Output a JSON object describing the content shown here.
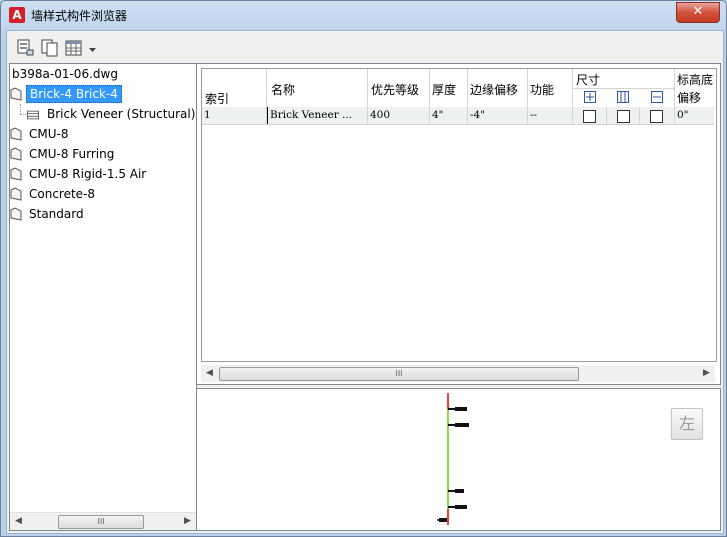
{
  "window": {
    "title": "墙样式构件浏览器",
    "close_label": "✕"
  },
  "toolbar": {
    "buttons": [
      {
        "icon": "import-wall-style-icon"
      },
      {
        "icon": "copy-icon"
      },
      {
        "icon": "table-view-icon"
      }
    ],
    "dropdown_icon": "chevron-down-icon"
  },
  "tree": {
    "root": "b398a-01-06.dwg",
    "items": [
      {
        "label": "Brick-4 Brick-4",
        "selected": true,
        "children": [
          {
            "label": "Brick Veneer (Structural)"
          }
        ]
      },
      {
        "label": "CMU-8"
      },
      {
        "label": "CMU-8 Furring"
      },
      {
        "label": "CMU-8 Rigid-1.5 Air"
      },
      {
        "label": "Concrete-8"
      },
      {
        "label": "Standard"
      }
    ]
  },
  "grid": {
    "headers": {
      "index": "索引",
      "name": "名称",
      "priority": "优先等级",
      "thickness": "厚度",
      "edge_offset": "边缘偏移",
      "function": "功能",
      "dimension": "尺寸",
      "base_height_line1": "标高底",
      "base_height_line2": "偏移"
    },
    "dimension_icons": [
      "dim-exterior-icon",
      "dim-center-icon",
      "dim-interior-icon"
    ],
    "rows": [
      {
        "index": "1",
        "name": "Brick Veneer ...",
        "priority": "400",
        "thickness": "4\"",
        "edge_offset": "-4\"",
        "function": "--",
        "dim_checks": [
          false,
          false,
          false
        ],
        "base_offset": "0\""
      }
    ]
  },
  "preview": {
    "view_button_label": "左",
    "accent_red": "#e00000",
    "accent_green": "#66cc00"
  },
  "scrollbar": {
    "grip": "III"
  },
  "colors": {
    "selection": "#3399ff",
    "title_bar": "#bcd3ec"
  }
}
